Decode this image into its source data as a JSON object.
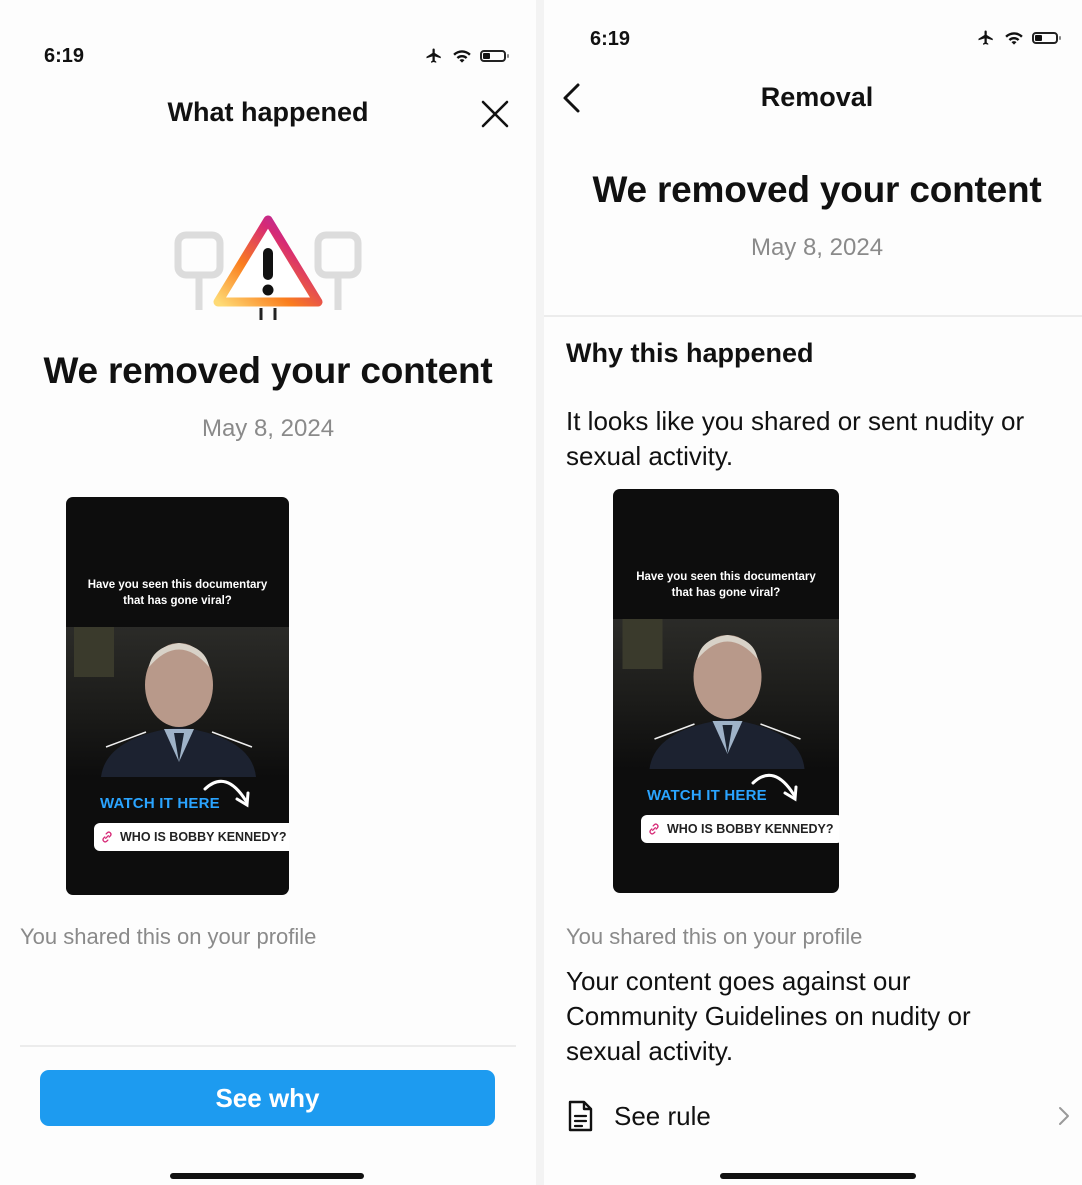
{
  "left": {
    "status": {
      "time": "6:19"
    },
    "header": {
      "title": "What happened",
      "close_icon": "close-icon"
    },
    "hero": {
      "icon": "warning-triangle-icon",
      "colors": [
        "#feda75",
        "#fa7e1e",
        "#d62976",
        "#962fbf"
      ]
    },
    "headline": "We removed your content",
    "date": "May 8, 2024",
    "media": {
      "question": "Have you seen this documentary that has gone viral?",
      "cta": "WATCH IT HERE",
      "link_label": "WHO IS BOBBY KENNEDY?"
    },
    "shared_note": "You shared this on your profile",
    "button": {
      "label": "See why",
      "color": "#1d9bf0"
    }
  },
  "right": {
    "status": {
      "time": "6:19"
    },
    "header": {
      "title": "Removal",
      "back_icon": "chevron-left-icon"
    },
    "headline": "We removed your content",
    "date": "May 8, 2024",
    "section_title": "Why this happened",
    "reason": "It looks like you shared or sent nudity or sexual activity.",
    "media": {
      "question": "Have you seen this documentary that has gone viral?",
      "cta": "WATCH IT HERE",
      "link_label": "WHO IS BOBBY KENNEDY?"
    },
    "shared_note": "You shared this on your profile",
    "guidelines": "Your content goes against our Community Guidelines on nudity or sexual activity.",
    "rule_link": {
      "label": "See rule",
      "icon": "document-icon",
      "chevron": "chevron-right-icon"
    }
  }
}
